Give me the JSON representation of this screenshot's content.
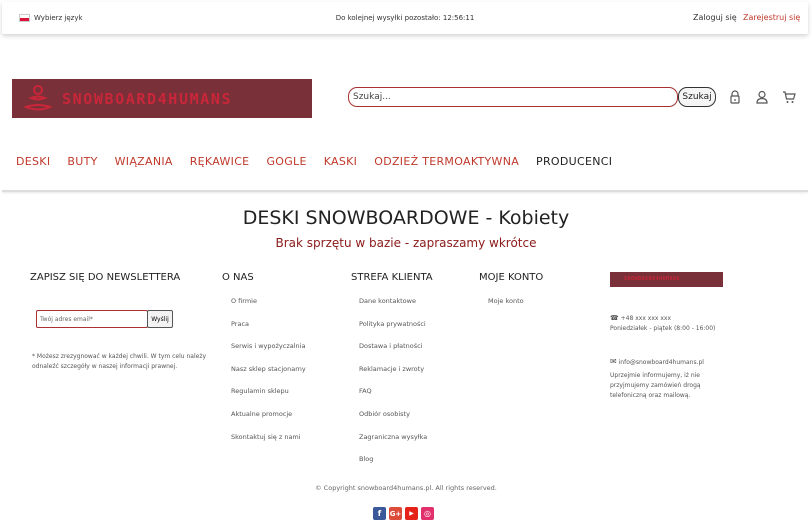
{
  "topbar": {
    "language": "Wybierz język",
    "countdown": "Do kolejnej wysyłki pozostało: 12:56:11",
    "login": "Zaloguj się",
    "register": "Zarejestruj się"
  },
  "logo": {
    "text": "SNOWBOARD4HUMANS"
  },
  "search": {
    "placeholder": "Szukaj...",
    "button": "Szukaj"
  },
  "header_icons": [
    "lock-icon",
    "user-icon",
    "cart-icon"
  ],
  "nav": {
    "items": [
      "DESKI",
      "BUTY",
      "WIĄZANIA",
      "RĘKAWICE",
      "GOGLE",
      "KASKI",
      "ODZIEŻ TERMOAKTYWNA",
      "PRODUCENCI"
    ]
  },
  "main": {
    "title": "DESKI SNOWBOARDOWE - Kobiety",
    "message": "Brak sprzętu w bazie - zapraszamy wkrótce"
  },
  "footer": {
    "newsletter": {
      "title": "ZAPISZ SIĘ DO NEWSLETTERA",
      "placeholder": "Twój adres email*",
      "button": "Wyślij",
      "note": "* Możesz zrezygnować w każdej chwili. W tym celu należy odnaleźć szczegóły w naszej informacji prawnej."
    },
    "about": {
      "title": "O NAS",
      "links": [
        "O firmie",
        "Praca",
        "Serwis i wypożyczalnia",
        "Nasz sklep stacjonarny",
        "Regulamin sklepu",
        "Aktualne promocje",
        "Skontaktuj się z nami"
      ]
    },
    "client": {
      "title": "STREFA KLIENTA",
      "links": [
        "Dane kontaktowe",
        "Polityka prywatności",
        "Dostawa i płatności",
        "Reklamacje i zwroty",
        "FAQ",
        "Odbiór osobisty",
        "Zagraniczna wysyłka",
        "Blog"
      ]
    },
    "account": {
      "title": "MOJE KONTO",
      "links": [
        "Moje konto"
      ]
    },
    "contact": {
      "phone": "+48 xxx xxx xxx",
      "hours": "Poniedziałek - piątek (8:00 - 16:00)",
      "email": "info@snowboard4humans.pl",
      "note": "Uprzejmie informujemy, iż nie przyjmujemy zamówień drogą telefoniczną oraz mailową."
    },
    "copyright": "© Copyright snowboard4humans.pl. All rights reserved.",
    "socials": [
      "facebook-icon",
      "google-plus-icon",
      "youtube-icon",
      "instagram-icon"
    ]
  },
  "colors": {
    "brand_red": "#c0392b",
    "logo_bg": "#7a3038",
    "dark_red": "#8b1a1a"
  }
}
